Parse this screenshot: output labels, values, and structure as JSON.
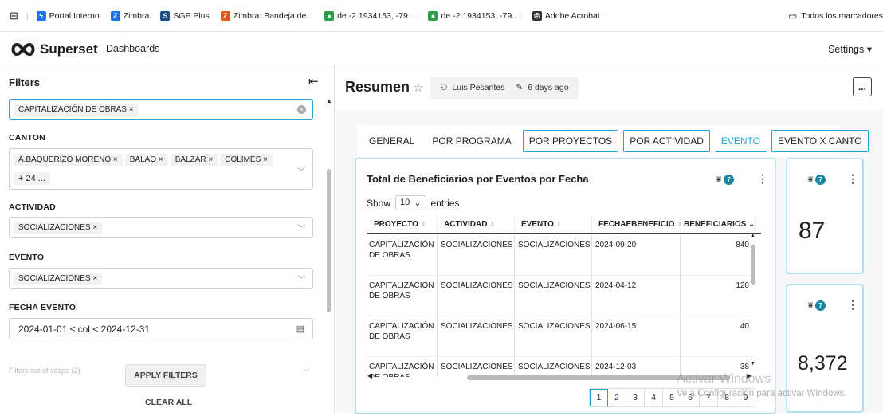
{
  "bookmarks": [
    {
      "label": "Portal Interno",
      "icon": "lightning-icon",
      "color": "#1a73e8"
    },
    {
      "label": "Zimbra",
      "icon": "zimbra-icon",
      "color": "#1a73e8"
    },
    {
      "label": "SGP Plus",
      "icon": "sgp-icon",
      "color": "#1a4f8b"
    },
    {
      "label": "Zimbra: Bandeja de...",
      "icon": "zimbra-mail-icon",
      "color": "#e05a1b"
    },
    {
      "label": "de -2.1934153, -79....",
      "icon": "map-pin-icon",
      "color": "#2e9d48"
    },
    {
      "label": "de -2.1934153, -79....",
      "icon": "map-pin-icon",
      "color": "#2e9d48"
    },
    {
      "label": "Adobe Acrobat",
      "icon": "acrobat-icon",
      "color": "#333333"
    }
  ],
  "all_bookmarks_label": "Todos los marcadores",
  "app": {
    "name": "Superset",
    "nav_dashboards": "Dashboards",
    "settings": "Settings ▾"
  },
  "filters": {
    "title": "Filters",
    "first_filter_value": "CAPITALIZACIÓN DE OBRAS ×",
    "canton": {
      "label": "CANTON",
      "tags": [
        "A.BAQUERIZO MORENO ×",
        "BALAO ×",
        "BALZAR ×",
        "COLIMES ×",
        "+ 24 ..."
      ]
    },
    "actividad": {
      "label": "ACTIVIDAD",
      "tags": [
        "SOCIALIZACIONES ×"
      ]
    },
    "evento": {
      "label": "EVENTO",
      "tags": [
        "SOCIALIZACIONES ×"
      ]
    },
    "fecha_evento": {
      "label": "FECHA EVENTO",
      "value": "2024-01-01 ≤ col < 2024-12-31"
    },
    "out_of_scope": "Filters out of scope (2)",
    "apply_label": "APPLY FILTERS",
    "clear_label": "CLEAR ALL"
  },
  "dashboard": {
    "title": "Resumen",
    "owner": "Luis Pesantes",
    "modified": "6 days ago",
    "more_label": "...",
    "tabs": [
      "GENERAL",
      "POR PROGRAMA",
      "POR PROYECTOS",
      "POR ACTIVIDAD",
      "EVENTO",
      "EVENTO X CANTO"
    ],
    "tabs_more": "···"
  },
  "table_chart": {
    "title": "Total de Beneficiarios por Eventos por Fecha",
    "filter_count": "7",
    "show_label": "Show",
    "entries_value": "10",
    "entries_label": "entries",
    "columns": [
      "PROYECTO",
      "ACTIVIDAD",
      "EVENTO",
      "FECHAEBENEFICIO",
      "BENEFICIARIOS"
    ],
    "rows": [
      [
        "CAPITALIZACIÓN DE OBRAS",
        "SOCIALIZACIONES",
        "SOCIALIZACIONES",
        "2024-09-20",
        "840"
      ],
      [
        "CAPITALIZACIÓN DE OBRAS",
        "SOCIALIZACIONES",
        "SOCIALIZACIONES",
        "2024-04-12",
        "120"
      ],
      [
        "CAPITALIZACIÓN DE OBRAS",
        "SOCIALIZACIONES",
        "SOCIALIZACIONES",
        "2024-06-15",
        "40"
      ],
      [
        "CAPITALIZACIÓN DE OBRAS",
        "SOCIALIZACIONES",
        "SOCIALIZACIONES",
        "2024-12-03",
        "38"
      ]
    ],
    "pages": [
      "1",
      "2",
      "3",
      "4",
      "5",
      "6",
      "7",
      "8",
      "9"
    ]
  },
  "kpi1": {
    "value": "87",
    "filter_count": "7"
  },
  "kpi2": {
    "value": "8,372",
    "filter_count": "7"
  },
  "watermark": {
    "line1": "Activar Windows",
    "line2": "Ve a Configuración para activar Windows."
  }
}
